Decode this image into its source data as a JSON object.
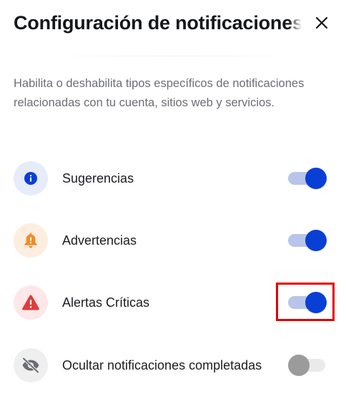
{
  "header": {
    "title": "Configuración de notificaciones",
    "close_icon": "close-icon"
  },
  "description": "Habilita o deshabilita tipos específicos de notificaciones relacionadas con tu cuenta, sitios web y servicios.",
  "settings": [
    {
      "label": "Sugerencias",
      "icon": "info-icon",
      "enabled": true,
      "icon_color": "#0a3fd6",
      "icon_bg": "#e7ecfb"
    },
    {
      "label": "Advertencias",
      "icon": "bell-icon",
      "enabled": true,
      "icon_color": "#f28c28",
      "icon_bg": "#fdeee0"
    },
    {
      "label": "Alertas Críticas",
      "icon": "warning-icon",
      "enabled": true,
      "icon_color": "#e23b3b",
      "icon_bg": "#fce8e8"
    },
    {
      "label": "Ocultar notificaciones completadas",
      "icon": "eye-slash-icon",
      "enabled": false,
      "icon_color": "#6b6e75",
      "icon_bg": "#efefef"
    }
  ],
  "colors": {
    "accent": "#0a3fd6",
    "toggle_track_on": "#b8c4ea",
    "toggle_off": "#9b9b9b",
    "highlight": "#e60000"
  }
}
